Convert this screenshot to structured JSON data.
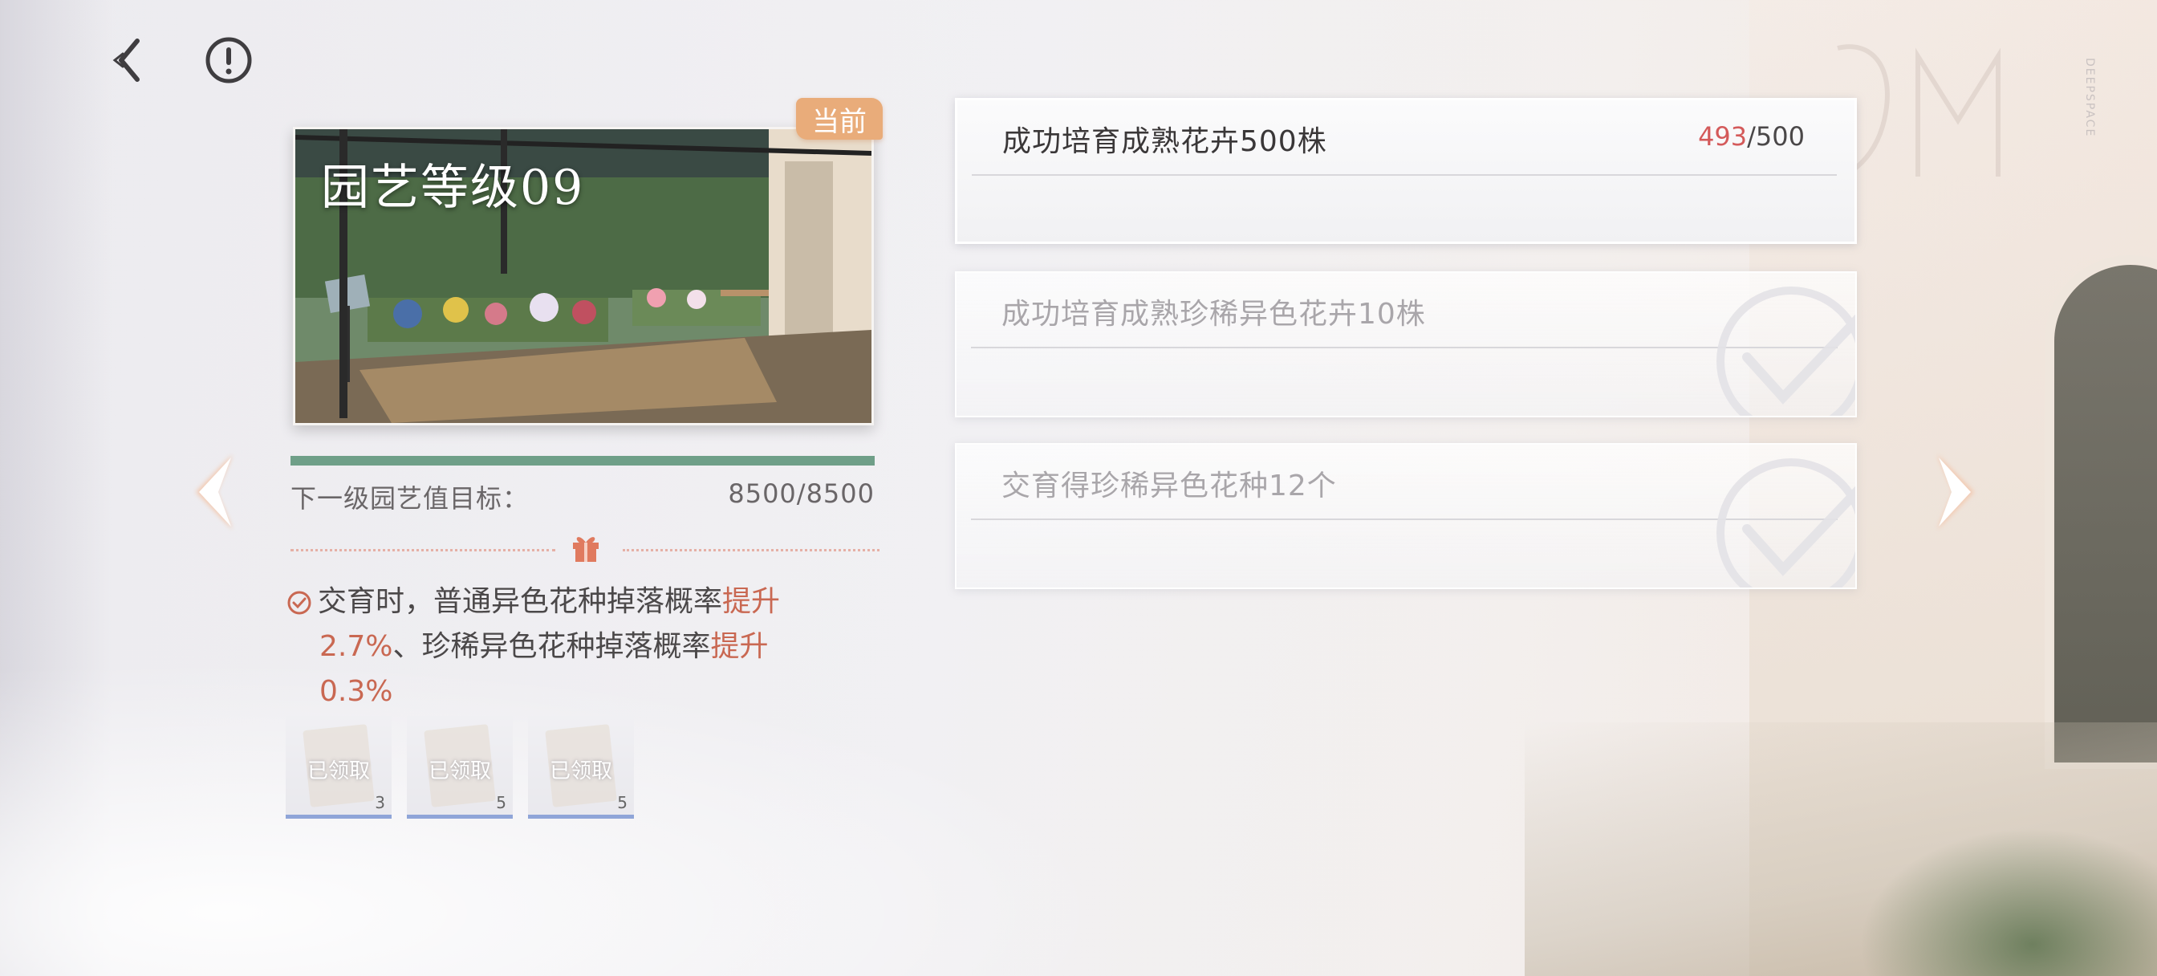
{
  "header": {
    "back_icon": "back-arrow-icon",
    "info_icon": "exclamation-circle-icon"
  },
  "level_card": {
    "title": "园艺等级09",
    "current_badge": "当前",
    "progress_fraction": 1.0,
    "target_label": "下一级园艺值目标：",
    "target_value": "8500/8500"
  },
  "reward": {
    "part1": "交育时，普通异色花种掉落概率",
    "hl1": "提升",
    "part2": "2.7%",
    "part3": "、珍稀异色花种掉落概率",
    "hl2": "提升",
    "part4": "0.3%",
    "items": [
      {
        "status": "已领取",
        "qty": "3"
      },
      {
        "status": "已领取",
        "qty": "5"
      },
      {
        "status": "已领取",
        "qty": "5"
      }
    ]
  },
  "tasks": [
    {
      "text": "成功培育成熟花卉500株",
      "current": "493",
      "total": "/500",
      "state": "in-progress"
    },
    {
      "text": "成功培育成熟珍稀异色花卉10株",
      "state": "completed"
    },
    {
      "text": "交育得珍稀异色花种12个",
      "state": "completed"
    }
  ],
  "decor": {
    "vertical_text": "DEEPSPACE"
  },
  "colors": {
    "accent_orange": "#e9ac7a",
    "progress_green": "#6f9f88",
    "highlight_red": "#c96852",
    "count_red": "#d45a5a"
  }
}
